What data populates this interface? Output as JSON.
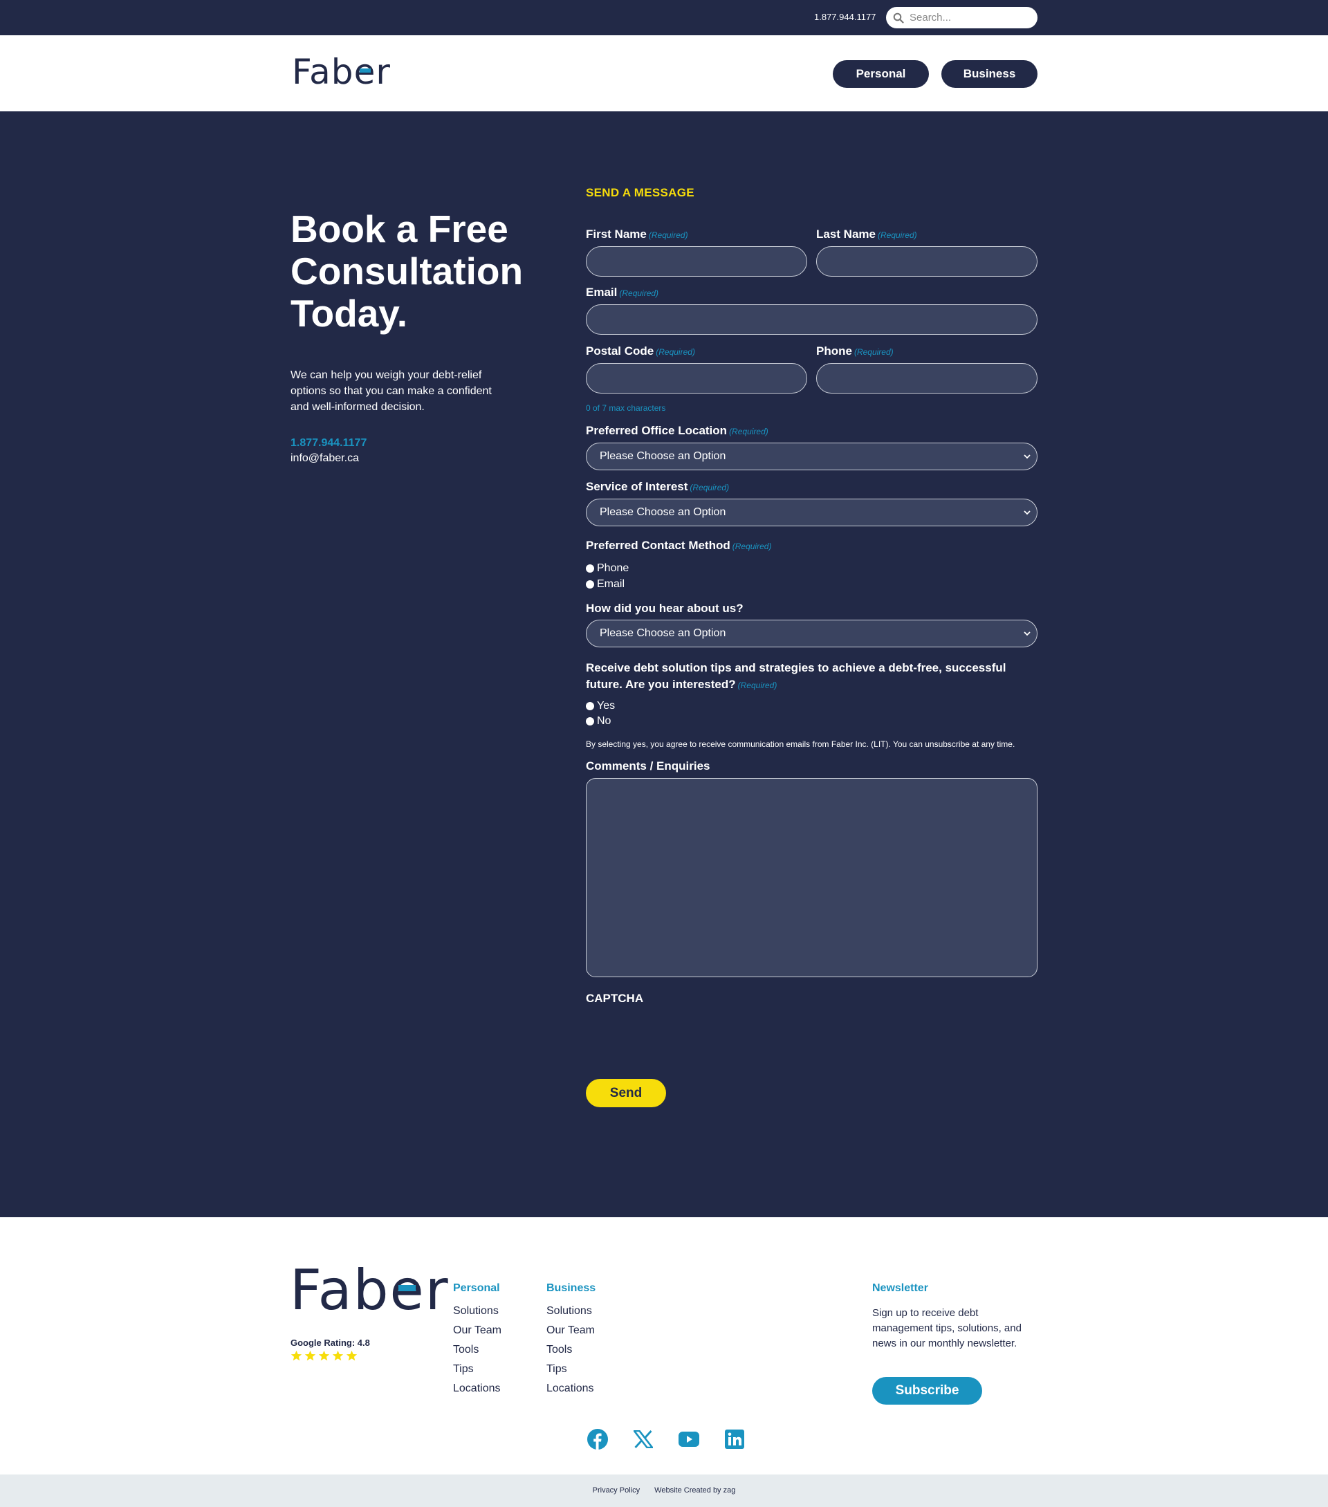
{
  "topbar": {
    "phone": "1.877.944.1177",
    "search_placeholder": "Search..."
  },
  "header": {
    "logo": "Faber",
    "nav": {
      "personal": "Personal",
      "business": "Business"
    }
  },
  "hero": {
    "title": "Book a Free Consultation Today.",
    "description": "We can help you weigh your debt-relief options so that you can make a confident and well-informed decision.",
    "phone": "1.877.944.1177",
    "email": "info@faber.ca"
  },
  "form": {
    "heading": "SEND A MESSAGE",
    "required_text": "(Required)",
    "first_name": "First Name",
    "last_name": "Last Name",
    "email": "Email",
    "postal_code": "Postal Code",
    "phone": "Phone",
    "postal_hint": "0 of 7 max characters",
    "office_location": "Preferred Office Location",
    "service": "Service of Interest",
    "contact_method": "Preferred Contact Method",
    "contact_options": [
      "Phone",
      "Email"
    ],
    "hear_about": "How did you hear about us?",
    "select_placeholder": "Please Choose an Option",
    "tips_question": "Receive debt solution tips and strategies to achieve a debt-free, successful future. Are you interested?",
    "tips_options": [
      "Yes",
      "No"
    ],
    "fine_print": "By selecting yes, you agree to receive communication emails from Faber Inc. (LIT). You can unsubscribe at any time.",
    "comments": "Comments / Enquiries",
    "captcha": "CAPTCHA",
    "send": "Send"
  },
  "footer": {
    "logo": "Faber",
    "rating": "Google Rating: 4.8",
    "star_color": "#f7dd0b",
    "personal": {
      "title": "Personal",
      "links": [
        "Solutions",
        "Our Team",
        "Tools",
        "Tips",
        "Locations"
      ]
    },
    "business": {
      "title": "Business",
      "links": [
        "Solutions",
        "Our Team",
        "Tools",
        "Tips",
        "Locations"
      ]
    },
    "newsletter": {
      "title": "Newsletter",
      "text": "Sign up to receive debt management tips, solutions, and news in our monthly newsletter.",
      "button": "Subscribe"
    },
    "socials": [
      "facebook-icon",
      "x-icon",
      "youtube-icon",
      "linkedin-icon"
    ],
    "bottom_links": [
      "Privacy Policy",
      "Website Created by zag"
    ]
  },
  "colors": {
    "navy": "#222947",
    "accent_blue": "#1a93c0",
    "accent_yellow": "#f7dd0b",
    "field_bg": "#3a4360"
  }
}
